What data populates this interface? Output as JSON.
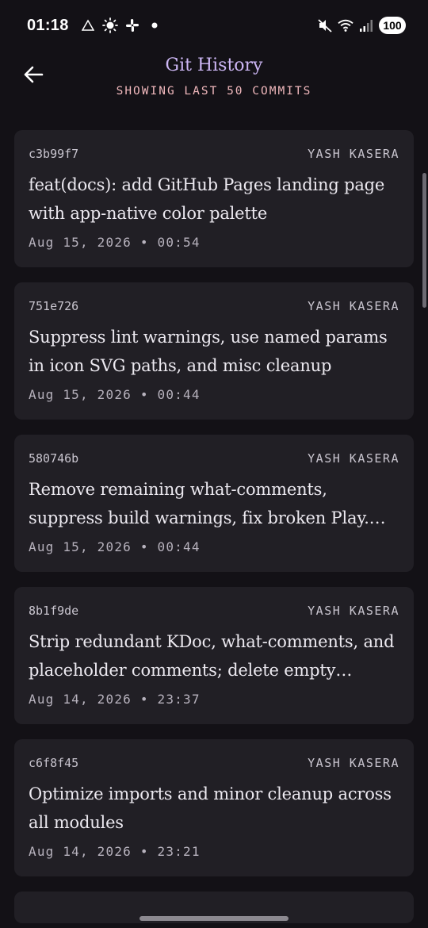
{
  "status_bar": {
    "time": "01:18",
    "battery": "100",
    "left_icons": [
      "alert-triangle-icon",
      "brightness-icon",
      "slack-icon",
      "dot-icon"
    ],
    "right_icons": [
      "mute-icon",
      "wifi-icon",
      "signal-icon"
    ]
  },
  "header": {
    "title": "Git History",
    "subtitle": "SHOWING LAST 50 COMMITS",
    "back_icon": "arrow-left-icon"
  },
  "colors": {
    "background": "#131116",
    "card": "#211f25",
    "title_accent": "#cdb7f5",
    "subtitle_accent": "#f0b8bc"
  },
  "commits": [
    {
      "hash": "c3b99f7",
      "author": "YASH KASERA",
      "message": "feat(docs): add GitHub Pages landing page with app-native color palette",
      "date": "Aug 15, 2026 • 00:54"
    },
    {
      "hash": "751e726",
      "author": "YASH KASERA",
      "message": "Suppress lint warnings, use named params in icon SVG paths, and misc cleanup",
      "date": "Aug 15, 2026 • 00:44"
    },
    {
      "hash": "580746b",
      "author": "YASH KASERA",
      "message": "Remove remaining what-comments, suppress build warnings, fix broken Play.…",
      "date": "Aug 15, 2026 • 00:44"
    },
    {
      "hash": "8b1f9de",
      "author": "YASH KASERA",
      "message": "Strip redundant KDoc, what-comments, and placeholder comments; delete empty…",
      "date": "Aug 14, 2026 • 23:37"
    },
    {
      "hash": "c6f8f45",
      "author": "YASH KASERA",
      "message": "Optimize imports and minor cleanup across all modules",
      "date": "Aug 14, 2026 • 23:21"
    }
  ]
}
